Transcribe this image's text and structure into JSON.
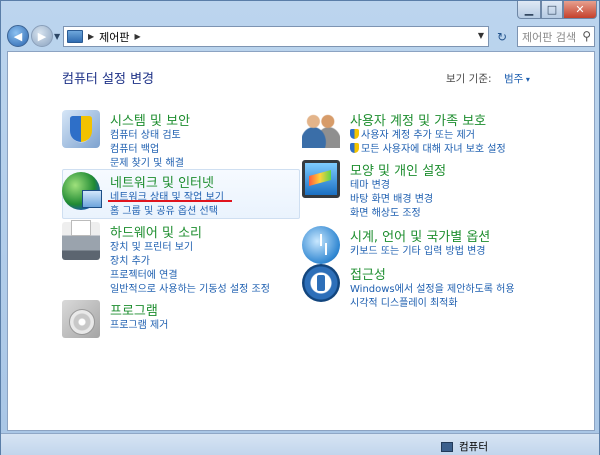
{
  "window": {
    "min_glyph": "▁",
    "max_glyph": "□",
    "close_glyph": "✕"
  },
  "nav": {
    "back_glyph": "◀",
    "forward_glyph": "▶",
    "address_path": "제어판",
    "address_sep": "▶",
    "refresh_glyph": "↻",
    "search_placeholder": "제어판 검색"
  },
  "header": {
    "title": "컴퓨터 설정 변경",
    "viewby_label": "보기 기준:",
    "viewby_value": "범주"
  },
  "categories_left": [
    {
      "icon": "shield-icon",
      "title": "시스템 및 보안",
      "links": [
        "컴퓨터 상태 검토",
        "컴퓨터 백업",
        "문제 찾기 및 해결"
      ]
    },
    {
      "icon": "network-globe-icon",
      "title": "네트워크 및 인터넷",
      "links": [
        "네트워크 상태 및 작업 보기",
        "홈 그룹 및 공유 옵션 선택"
      ]
    },
    {
      "icon": "printer-icon",
      "title": "하드웨어 및 소리",
      "links": [
        "장치 및 프린터 보기",
        "장치 추가",
        "프로젝터에 연결",
        "일반적으로 사용하는 기동성 설정 조정"
      ]
    },
    {
      "icon": "program-disc-icon",
      "title": "프로그램",
      "links": [
        "프로그램 제거"
      ]
    }
  ],
  "categories_right": [
    {
      "icon": "users-icon",
      "title": "사용자 계정 및 가족 보호",
      "links": [
        "사용자 계정 추가 또는 제거",
        "모든 사용자에 대해 자녀 보호 설정"
      ]
    },
    {
      "icon": "display-icon",
      "title": "모양 및 개인 설정",
      "links": [
        "테마 변경",
        "바탕 화면 배경 변경",
        "화면 해상도 조정"
      ]
    },
    {
      "icon": "clock-globe-icon",
      "title": "시계, 언어 및 국가별 옵션",
      "links": [
        "키보드 또는 기타 입력 방법 변경"
      ]
    },
    {
      "icon": "ease-of-access-icon",
      "title": "접근성",
      "links": [
        "Windows에서 설정을 제안하도록 허용",
        "시각적 디스플레이 최적화"
      ]
    }
  ],
  "status": {
    "computer_label": "컴퓨터"
  },
  "colors": {
    "category_title": "#1e8e2f",
    "link": "#1e5fb0",
    "page_title": "#1e3287",
    "highlight_underline": "#e0141e"
  }
}
